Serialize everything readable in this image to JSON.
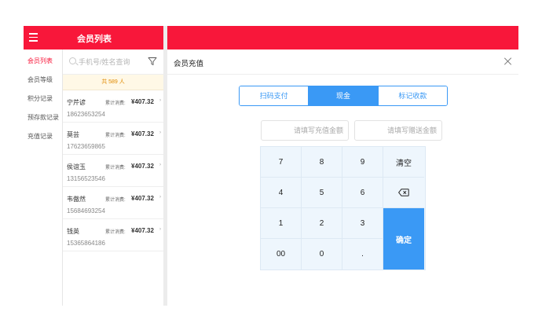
{
  "header": {
    "title": "会员列表",
    "menu_icon": "hamburger-icon"
  },
  "nav": {
    "items": [
      {
        "label": "会员列表",
        "active": true
      },
      {
        "label": "会员等级",
        "active": false
      },
      {
        "label": "积分记录",
        "active": false
      },
      {
        "label": "预存款记录",
        "active": false
      },
      {
        "label": "充值记录",
        "active": false
      }
    ]
  },
  "members": {
    "search_placeholder": "手机号/姓名查询",
    "total": "共 589 人",
    "spend_label": "累计消费:",
    "items": [
      {
        "name": "宁芹谚",
        "phone": "18623653254",
        "amount": "¥407.32"
      },
      {
        "name": "莫芸",
        "phone": "17623659865",
        "amount": "¥407.32"
      },
      {
        "name": "侯谊玉",
        "phone": "13156523546",
        "amount": "¥407.32"
      },
      {
        "name": "韦傲然",
        "phone": "15684693254",
        "amount": "¥407.32"
      },
      {
        "name": "钱英",
        "phone": "15365864186",
        "amount": "¥407.32"
      }
    ]
  },
  "panel": {
    "title": "会员充值",
    "tabs": [
      {
        "label": "扫码支付",
        "active": false
      },
      {
        "label": "现金",
        "active": true
      },
      {
        "label": "标记收款",
        "active": false
      }
    ],
    "recharge_placeholder": "请填写充值金额",
    "gift_placeholder": "请填写赠送金额",
    "keys": {
      "k7": "7",
      "k8": "8",
      "k9": "9",
      "clear": "清空",
      "k4": "4",
      "k5": "5",
      "k6": "6",
      "k1": "1",
      "k2": "2",
      "k3": "3",
      "confirm": "确定",
      "k00": "00",
      "k0": "0",
      "dot": "."
    }
  },
  "colors": {
    "brand_red": "#f8173a",
    "accent_blue": "#3a99f5",
    "keypad_bg": "#eef6fd"
  }
}
